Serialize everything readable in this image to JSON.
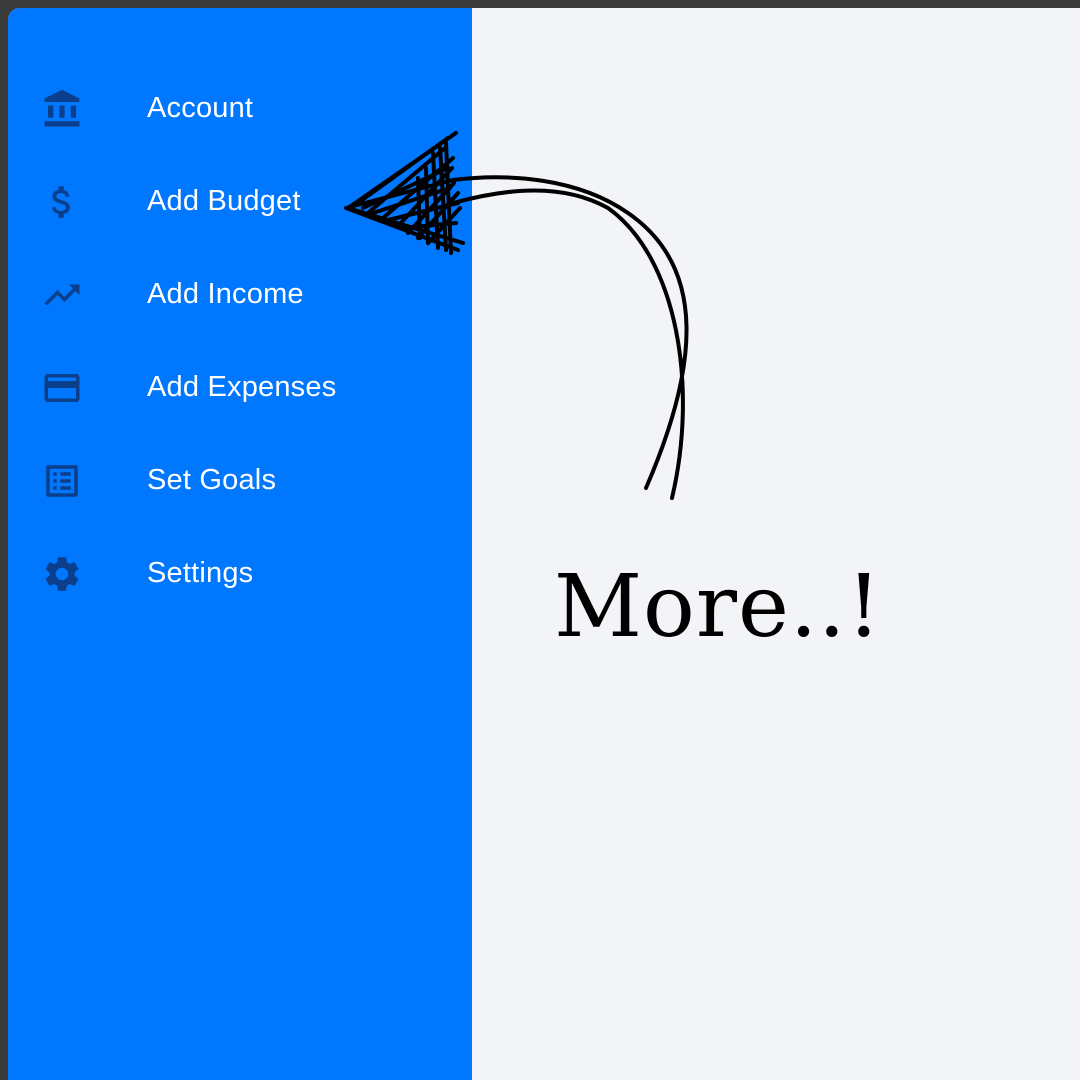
{
  "sidebar": {
    "items": [
      {
        "label": "Account",
        "icon": "bank-icon"
      },
      {
        "label": "Add Budget",
        "icon": "dollar-icon"
      },
      {
        "label": "Add Income",
        "icon": "trending-up-icon"
      },
      {
        "label": "Add Expenses",
        "icon": "credit-card-icon"
      },
      {
        "label": "Set Goals",
        "icon": "list-icon"
      },
      {
        "label": "Settings",
        "icon": "gear-icon"
      }
    ]
  },
  "main": {
    "annotation_text": "More..!",
    "arrow_icon": "hand-drawn-arrow-icon"
  },
  "colors": {
    "sidebar_bg": "#0077ff",
    "icon_color": "#0b3f8c",
    "label_color": "#ffffff",
    "main_bg": "#f3f4f7",
    "frame_bg": "#3a3a3a"
  }
}
